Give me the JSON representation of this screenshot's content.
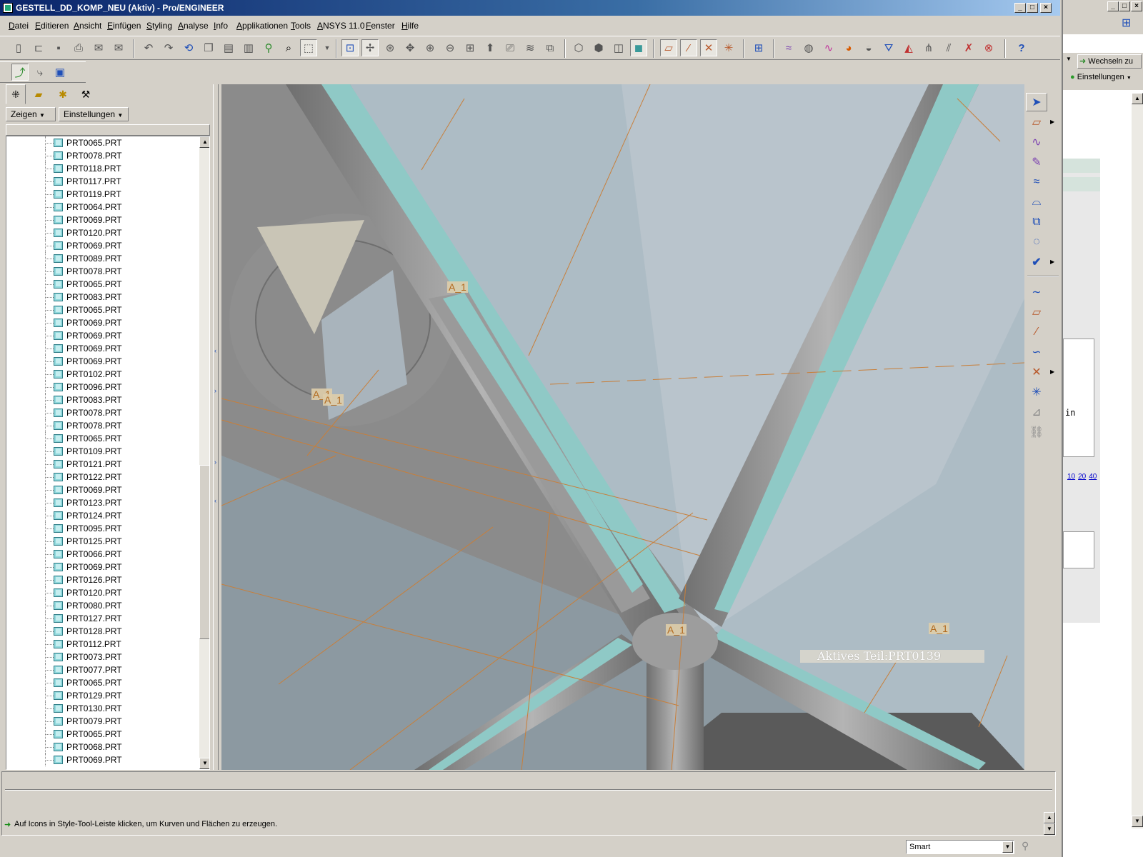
{
  "window": {
    "title": "GESTELL_DD_KOMP_NEU (Aktiv) - Pro/ENGINEER",
    "min": "_",
    "max": "□",
    "close": "×"
  },
  "menu": [
    "Datei",
    "Editieren",
    "Ansicht",
    "Einfügen",
    "Styling",
    "Analyse",
    "Info",
    "Applikationen",
    "Tools",
    "ANSYS 11.0",
    "Fenster",
    "Hilfe"
  ],
  "tree": {
    "show_label": "Zeigen",
    "settings_label": "Einstellungen",
    "items": [
      "PRT0065.PRT",
      "PRT0078.PRT",
      "PRT0118.PRT",
      "PRT0117.PRT",
      "PRT0119.PRT",
      "PRT0064.PRT",
      "PRT0069.PRT",
      "PRT0120.PRT",
      "PRT0069.PRT",
      "PRT0089.PRT",
      "PRT0078.PRT",
      "PRT0065.PRT",
      "PRT0083.PRT",
      "PRT0065.PRT",
      "PRT0069.PRT",
      "PRT0069.PRT",
      "PRT0069.PRT",
      "PRT0069.PRT",
      "PRT0102.PRT",
      "PRT0096.PRT",
      "PRT0083.PRT",
      "PRT0078.PRT",
      "PRT0078.PRT",
      "PRT0065.PRT",
      "PRT0109.PRT",
      "PRT0121.PRT",
      "PRT0122.PRT",
      "PRT0069.PRT",
      "PRT0123.PRT",
      "PRT0124.PRT",
      "PRT0095.PRT",
      "PRT0125.PRT",
      "PRT0066.PRT",
      "PRT0069.PRT",
      "PRT0126.PRT",
      "PRT0120.PRT",
      "PRT0080.PRT",
      "PRT0127.PRT",
      "PRT0128.PRT",
      "PRT0112.PRT",
      "PRT0073.PRT",
      "PRT0077.PRT",
      "PRT0065.PRT",
      "PRT0129.PRT",
      "PRT0130.PRT",
      "PRT0079.PRT",
      "PRT0065.PRT",
      "PRT0068.PRT",
      "PRT0069.PRT"
    ]
  },
  "viewport": {
    "active_part": "Aktives Teil:PRT0139",
    "datum_labels": [
      "A_1",
      "A_1",
      "A_1",
      "A_1",
      "A_1"
    ]
  },
  "status": {
    "message": "Auf Icons in Style-Tool-Leiste klicken, um Kurven und Flächen zu erzeugen.",
    "filter_value": "Smart"
  },
  "side_window": {
    "switch_label": "Wechseln zu",
    "settings_label": "Einstellungen",
    "snippet_text": "in",
    "page_links": [
      "10",
      "20",
      "40"
    ]
  },
  "colors": {
    "viewport_bg": "#adbcc5",
    "tube_gray": "#8d8d8d",
    "tube_cyan": "#8fc9c6",
    "datum_orange": "#c87f3a",
    "titlebar": "#0a246a"
  }
}
